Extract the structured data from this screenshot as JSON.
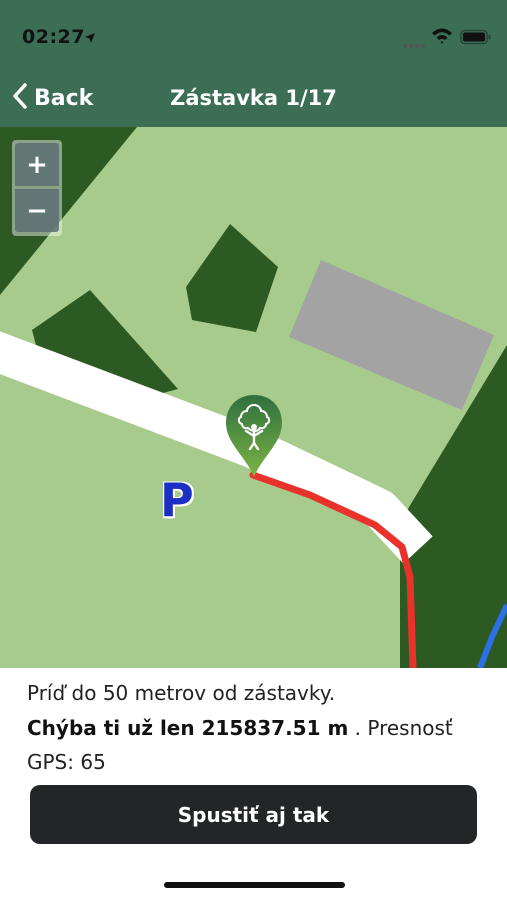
{
  "status_bar": {
    "time": "02:27",
    "icons": [
      "location-arrow-icon",
      "signal-icon",
      "wifi-icon",
      "battery-icon"
    ]
  },
  "nav": {
    "back_label": "Back",
    "title": "Zástavka 1/17"
  },
  "map": {
    "zoom_in_label": "+",
    "zoom_out_label": "−",
    "parking_label": "P",
    "marker_icon": "tree-person-marker-icon",
    "colors": {
      "ground": "#a7cb8c",
      "forest": "#2d5a22",
      "building": "#a3a3a3",
      "road": "#ffffff",
      "route": "#e8322b",
      "water_line": "#2d6fe6",
      "marker": "#3f8a45"
    }
  },
  "info": {
    "line1": "Príď do 50 metrov od zástavky.",
    "distance_bold": "Chýba ti už len 215837.51 m",
    "accuracy_tail": " . Presnosť",
    "gps_label": "GPS: 65"
  },
  "action": {
    "label": "Spustiť aj tak"
  }
}
